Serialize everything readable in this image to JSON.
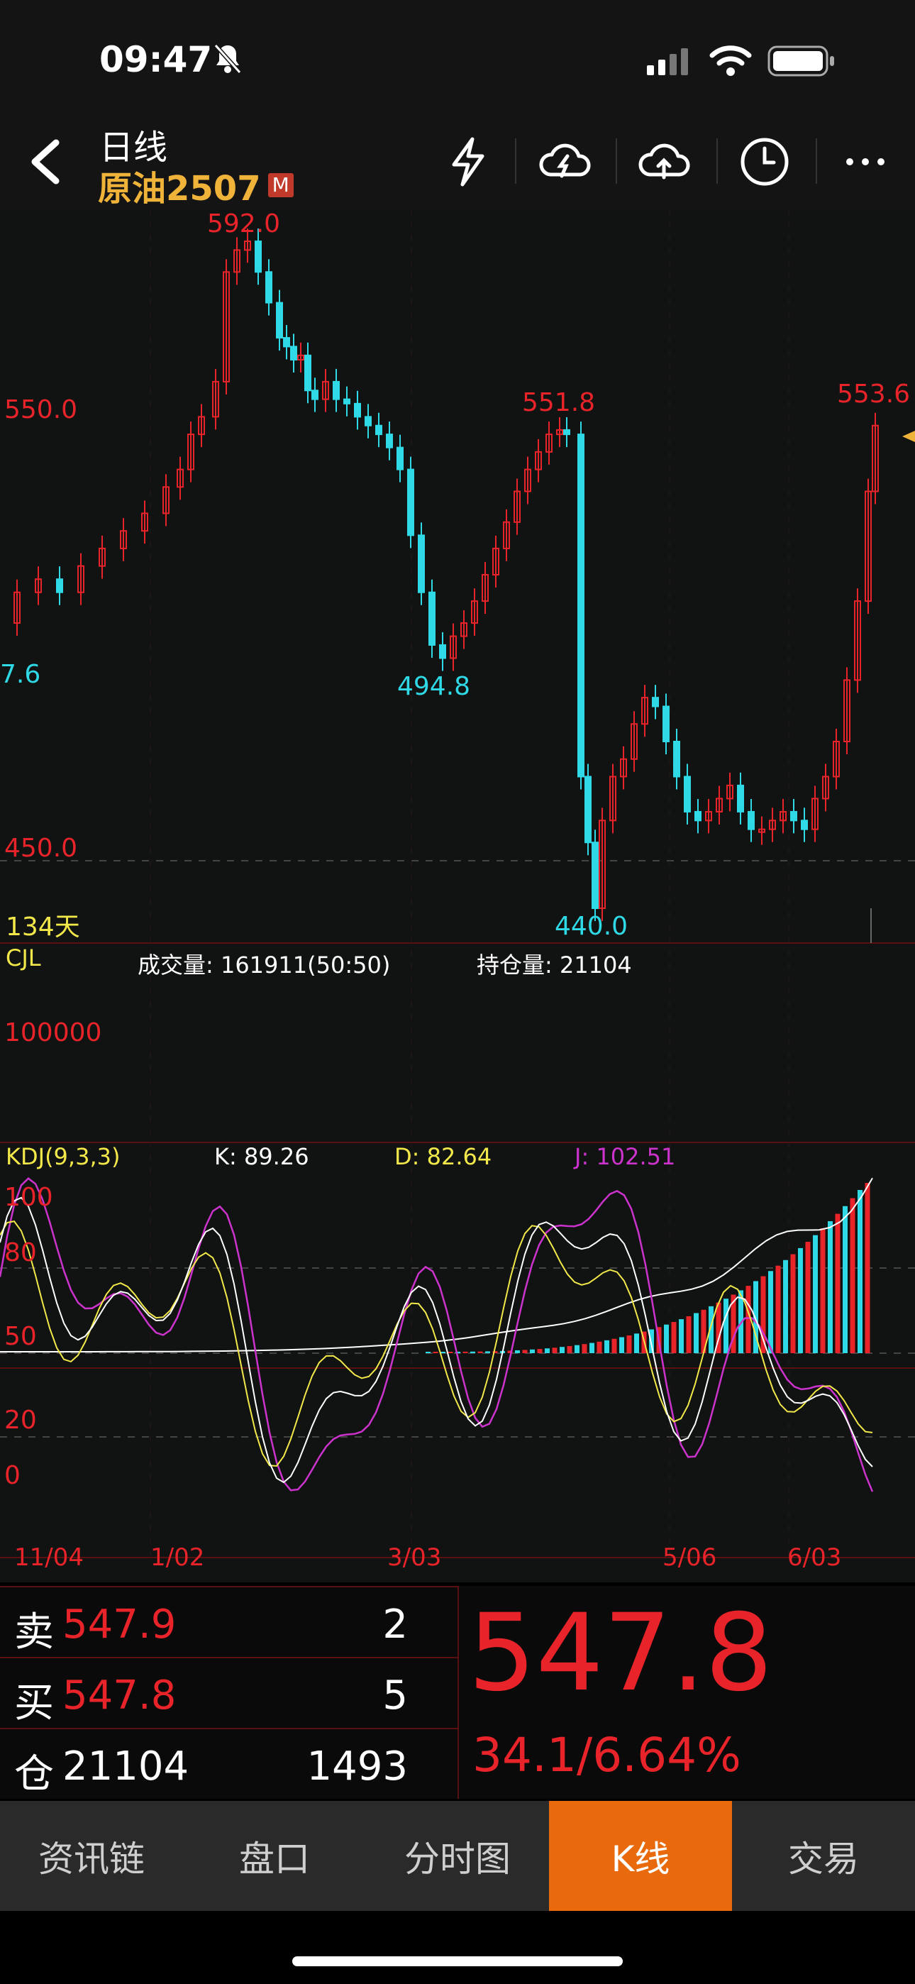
{
  "status": {
    "time": "09:47"
  },
  "header": {
    "title": "日线",
    "symbol": "原油2507",
    "badge": "M"
  },
  "icons": {
    "back": "back-chevron-icon",
    "flash": "lightning-icon",
    "cloud_download": "cloud-download-icon",
    "cloud_upload": "cloud-upload-icon",
    "history": "clock-icon",
    "more": "more-dots-icon"
  },
  "price_chart": {
    "high_label": "592.0",
    "mid_high_label": "551.8",
    "recent_high_label": "553.6",
    "low_label": "494.8",
    "bottom_label": "440.0",
    "left_partial_label": "7.6",
    "y_ticks": [
      "550.0",
      "450.0"
    ],
    "days_label": "134天"
  },
  "volume": {
    "indicator": "CJL",
    "volume_text": "成交量: 161911(50:50)",
    "oi_text": "持仓量: 21104",
    "tick": "100000"
  },
  "kdj": {
    "indicator": "KDJ(9,3,3)",
    "k_text": "K: 89.26",
    "d_text": "D: 82.64",
    "j_text": "J: 102.51",
    "ticks": [
      "100",
      "80",
      "50",
      "20",
      "0"
    ]
  },
  "dates": [
    "11/04",
    "1/02",
    "3/03",
    "5/06",
    "6/03"
  ],
  "quote": {
    "sell_label": "卖",
    "sell_price": "547.9",
    "sell_vol": "2",
    "buy_label": "买",
    "buy_price": "547.8",
    "buy_vol": "5",
    "oi_label": "仓",
    "oi_value": "21104",
    "oi_change": "1493",
    "last_price": "547.8",
    "change_text": "34.1/6.64%"
  },
  "tabs": [
    "资讯链",
    "盘口",
    "分时图",
    "K线",
    "交易"
  ],
  "active_tab": "K线",
  "colors": {
    "up": "#e8242a",
    "down": "#2fd9e6",
    "accent": "#e86a0c",
    "k": "#ffffff",
    "d": "#f2e84a",
    "j": "#cc33cc"
  }
}
